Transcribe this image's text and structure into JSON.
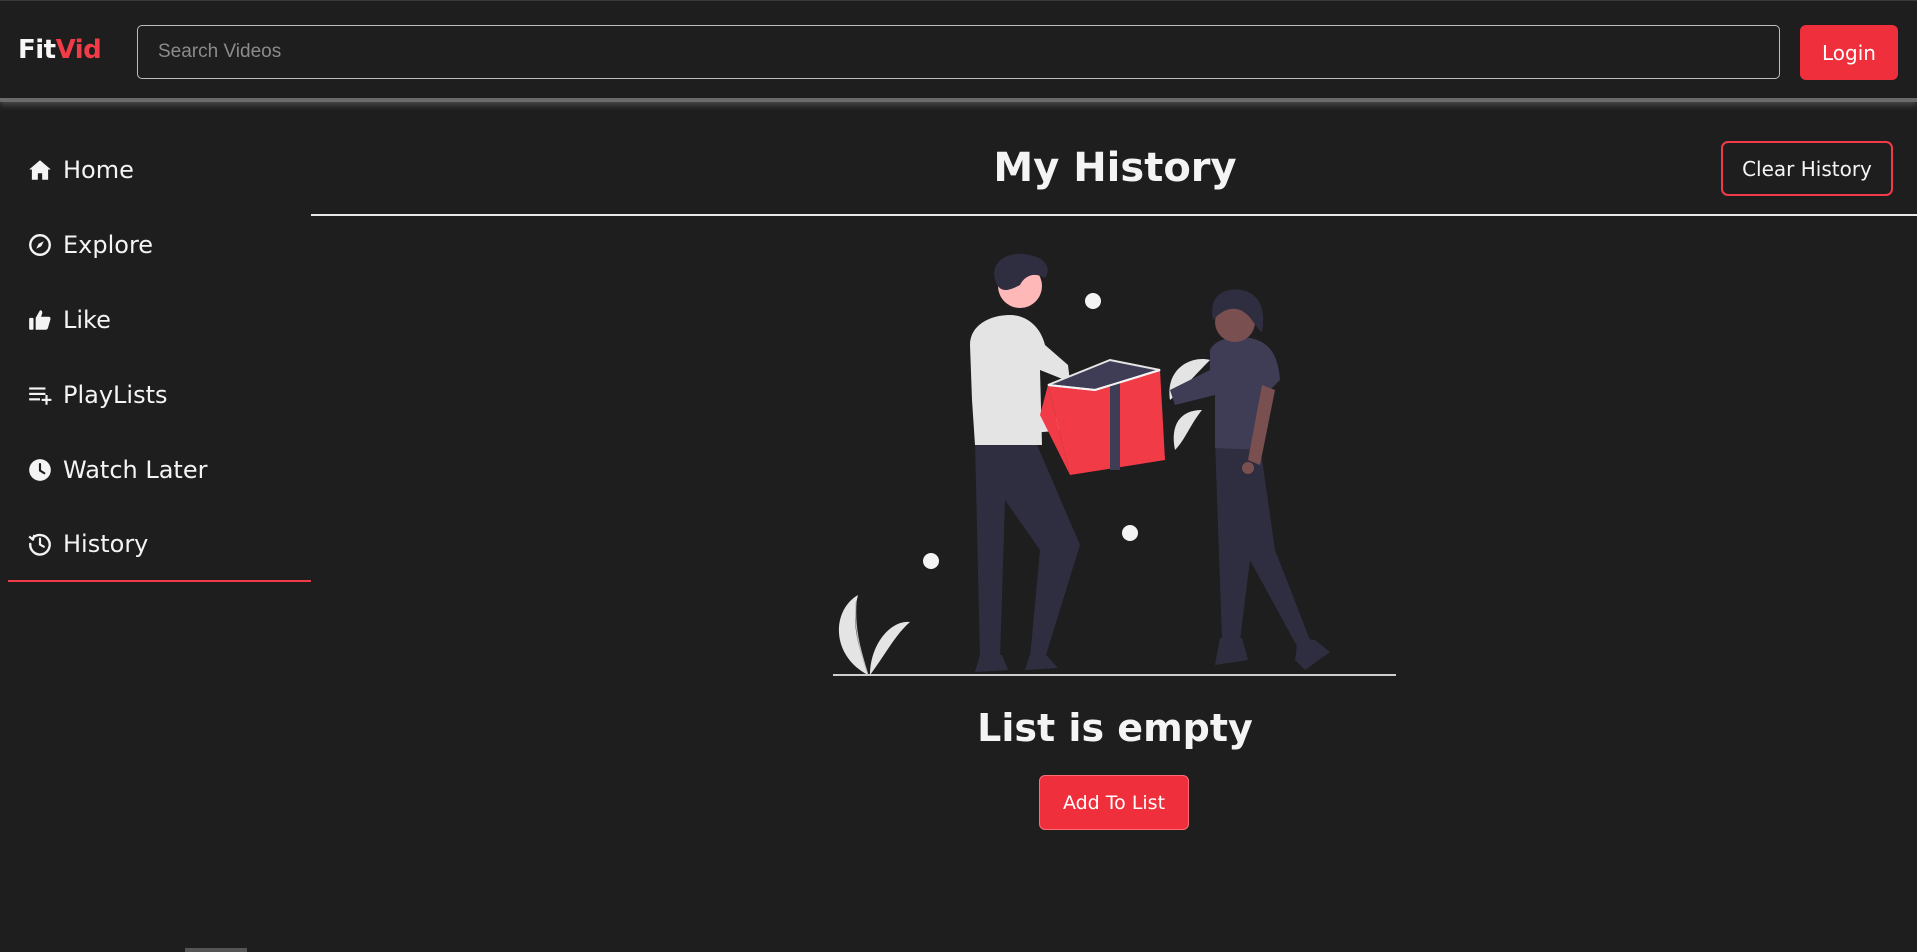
{
  "header": {
    "logo_part1": "Fit",
    "logo_part2": "Vid",
    "search_placeholder": "Search Videos",
    "login_label": "Login"
  },
  "sidebar": {
    "items": [
      {
        "label": "Home",
        "icon": "home-icon"
      },
      {
        "label": "Explore",
        "icon": "compass-icon"
      },
      {
        "label": "Like",
        "icon": "thumbs-up-icon"
      },
      {
        "label": "PlayLists",
        "icon": "playlist-add-icon"
      },
      {
        "label": "Watch Later",
        "icon": "clock-icon"
      },
      {
        "label": "History",
        "icon": "history-icon"
      }
    ],
    "active": "History"
  },
  "main": {
    "title": "My History",
    "clear_label": "Clear History",
    "empty_text": "List is empty",
    "add_label": "Add To List"
  },
  "colors": {
    "accent": "#f13b47",
    "background": "#1e1e1e",
    "text": "#f4f4f4"
  }
}
